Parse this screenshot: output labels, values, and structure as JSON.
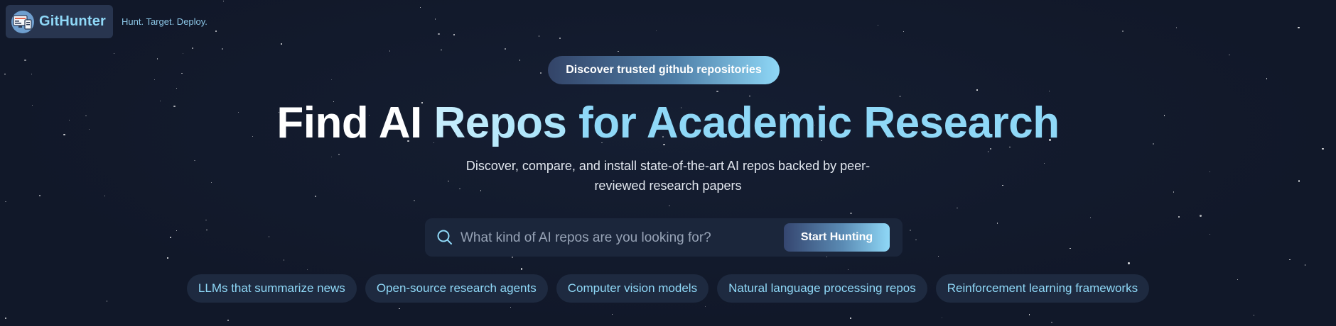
{
  "brand": {
    "name": "GitHunter",
    "tagline": "Hunt. Target. Deploy."
  },
  "hero": {
    "badge": "Discover trusted github repositories",
    "headline_part1": "Find AI",
    "headline_part2": "Repos",
    "headline_part3": "for Academic Research",
    "subtitle": "Discover, compare, and install state-of-the-art AI repos backed by peer-reviewed research papers"
  },
  "search": {
    "placeholder": "What kind of AI repos are you looking for?",
    "value": "",
    "button_label": "Start Hunting"
  },
  "suggestions": [
    "LLMs that summarize news",
    "Open-source research agents",
    "Computer vision models",
    "Natural language processing repos",
    "Reinforcement learning frameworks"
  ],
  "colors": {
    "background": "#111829",
    "accent": "#8fd8f7",
    "chip_background": "#1e2a40"
  },
  "icons": {
    "logo": "computer-monitor-icon",
    "search": "search-icon"
  }
}
